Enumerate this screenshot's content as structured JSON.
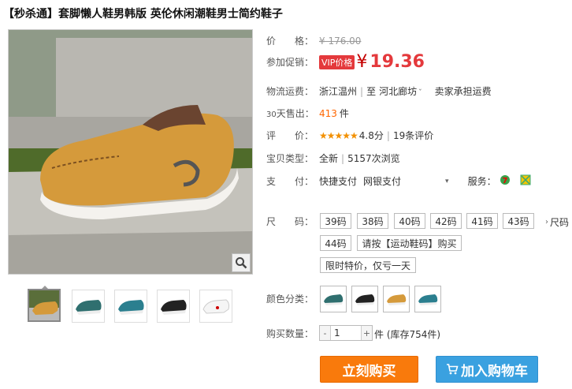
{
  "title": "【秒杀通】套脚懒人鞋男韩版 英伦休闲潮鞋男士简约鞋子",
  "price": {
    "label": "价　　格：",
    "original": "¥ 176.00"
  },
  "promo": {
    "label": "参加促销：",
    "vip_badge": "VIP价格",
    "yen": "¥",
    "value": "19.36"
  },
  "shipping": {
    "label": "物流运费：",
    "from": "浙江温州",
    "to_word": "至",
    "to": "河北廊坊",
    "fee": "卖家承担运费"
  },
  "sales": {
    "label_prefix": "30",
    "label_rest": "天售出：",
    "count": "413",
    "unit": "件"
  },
  "rating": {
    "label": "评　　价：",
    "stars": "★★★★★",
    "score": "4.8分",
    "reviews": "19条评价"
  },
  "type": {
    "label": "宝贝类型：",
    "value": "全新",
    "views": "5157次浏览"
  },
  "payment": {
    "label": "支　　付：",
    "methods": [
      "快捷支付",
      "网银支付"
    ],
    "service_label": "服务："
  },
  "size": {
    "label": "尺　　码：",
    "options": [
      "39码",
      "38码",
      "40码",
      "42码",
      "41码",
      "43码",
      "44码",
      "请按【运动鞋码】购买",
      "限时特价，仅亏一天"
    ],
    "more": "尺码"
  },
  "color": {
    "label": "颜色分类：",
    "options": [
      "teal",
      "black",
      "tan",
      "blue"
    ]
  },
  "quantity": {
    "label": "购买数量：",
    "value": "1",
    "minus": "-",
    "plus": "+",
    "stock": "件 (库存754件)"
  },
  "buttons": {
    "buy_now": "立刻购买",
    "add_cart": "加入购物车"
  },
  "colors": {
    "accent_red": "#e4393c",
    "buy_orange": "#f97a0c",
    "cart_blue": "#3aa1e0"
  },
  "icons": {
    "zoom": "magnifier-icon",
    "cart": "cart-icon"
  }
}
